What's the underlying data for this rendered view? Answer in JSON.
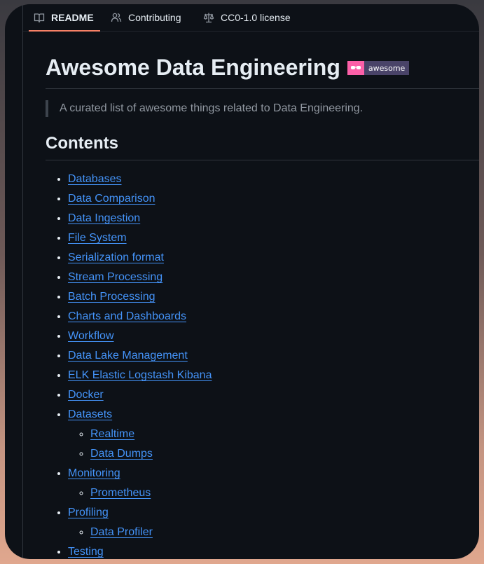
{
  "tabs": [
    {
      "label": "README",
      "icon": "book-icon",
      "active": true
    },
    {
      "label": "Contributing",
      "icon": "people-icon",
      "active": false
    },
    {
      "label": "CC0-1.0 license",
      "icon": "law-scale-icon",
      "active": false
    }
  ],
  "readme": {
    "title": "Awesome Data Engineering",
    "badge": {
      "label": "awesome",
      "icon": "sunglasses-icon",
      "color_left": "#fc60a8",
      "color_right": "#494368"
    },
    "description": "A curated list of awesome things related to Data Engineering.",
    "contents_heading": "Contents"
  },
  "toc": [
    {
      "label": "Databases"
    },
    {
      "label": "Data Comparison"
    },
    {
      "label": "Data Ingestion"
    },
    {
      "label": "File System"
    },
    {
      "label": "Serialization format"
    },
    {
      "label": "Stream Processing"
    },
    {
      "label": "Batch Processing"
    },
    {
      "label": "Charts and Dashboards"
    },
    {
      "label": "Workflow"
    },
    {
      "label": "Data Lake Management"
    },
    {
      "label": "ELK Elastic Logstash Kibana"
    },
    {
      "label": "Docker"
    },
    {
      "label": "Datasets",
      "children": [
        "Realtime",
        "Data Dumps"
      ]
    },
    {
      "label": "Monitoring",
      "children": [
        "Prometheus"
      ]
    },
    {
      "label": "Profiling",
      "children": [
        "Data Profiler"
      ]
    },
    {
      "label": "Testing"
    }
  ],
  "colors": {
    "background": "#0d1117",
    "text": "#e6edf3",
    "link": "#4493f8",
    "muted": "#9198a1",
    "tab_underline": "#f78166"
  }
}
